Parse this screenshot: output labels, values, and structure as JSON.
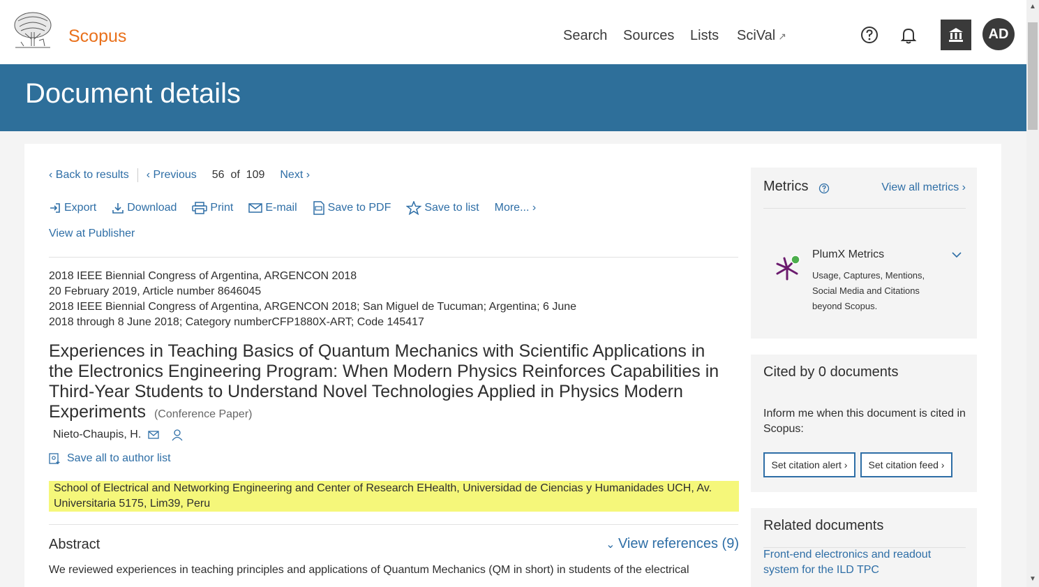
{
  "header": {
    "brand": "Scopus",
    "nav": [
      {
        "label": "Search"
      },
      {
        "label": "Sources"
      },
      {
        "label": "Lists"
      },
      {
        "label": "SciVal",
        "ext": "↗"
      }
    ],
    "avatar_initials": "AD"
  },
  "banner": {
    "title": "Document details"
  },
  "toolbar": {
    "back": "Back to results",
    "previous": "Previous",
    "current": "56",
    "of": "of",
    "total": "109",
    "next": "Next"
  },
  "actions": {
    "export": "Export",
    "download": "Download",
    "print": "Print",
    "email": "E-mail",
    "save_pdf": "Save to PDF",
    "save_list": "Save to list",
    "more": "More..."
  },
  "view_publisher": "View at Publisher",
  "source_lines": [
    "2018 IEEE Biennial Congress of Argentina, ARGENCON 2018",
    "20 February 2019, Article number 8646045",
    "2018 IEEE Biennial Congress of Argentina, ARGENCON 2018; San Miguel de Tucuman; Argentina; 6 June",
    "2018 through 8 June 2018; Category numberCFP1880X-ART; Code 145417"
  ],
  "document": {
    "title": "Experiences in Teaching Basics of Quantum Mechanics with Scientific Applications in the Electronics Engineering Program: When Modern Physics Reinforces Capabilities in Third-Year Students to Understand Novel Technologies Applied in Physics Modern Experiments",
    "type": "(Conference Paper)",
    "author": "Nieto-Chaupis, H.",
    "save_author": "Save all to author list",
    "affiliation": "School of Electrical and Networking Engineering and Center of Research EHealth, Universidad de Ciencias y Humanidades UCH, Av. Universitaria 5175, Lim39, Peru",
    "abstract_heading": "Abstract",
    "view_references": "View references (9)",
    "abstract_text": "We reviewed experiences in teaching principles and applications of Quantum Mechanics (QM in short) in students of the electrical"
  },
  "metrics": {
    "heading": "Metrics",
    "view_all": "View all metrics",
    "plumx_title": "PlumX Metrics",
    "plumx_desc": "Usage, Captures, Mentions, Social Media and Citations beyond Scopus."
  },
  "cited": {
    "heading": "Cited by 0 documents",
    "text": "Inform me when this document is cited in Scopus:",
    "alert_btn": "Set citation alert",
    "feed_btn": "Set citation feed"
  },
  "related": {
    "heading": "Related documents",
    "first_link": "Front-end electronics and readout system for the ILD TPC"
  },
  "colors": {
    "accent": "#2e6ea6",
    "banner": "#2e6f9a",
    "brand": "#e9711c",
    "highlight": "#f5f77a"
  }
}
